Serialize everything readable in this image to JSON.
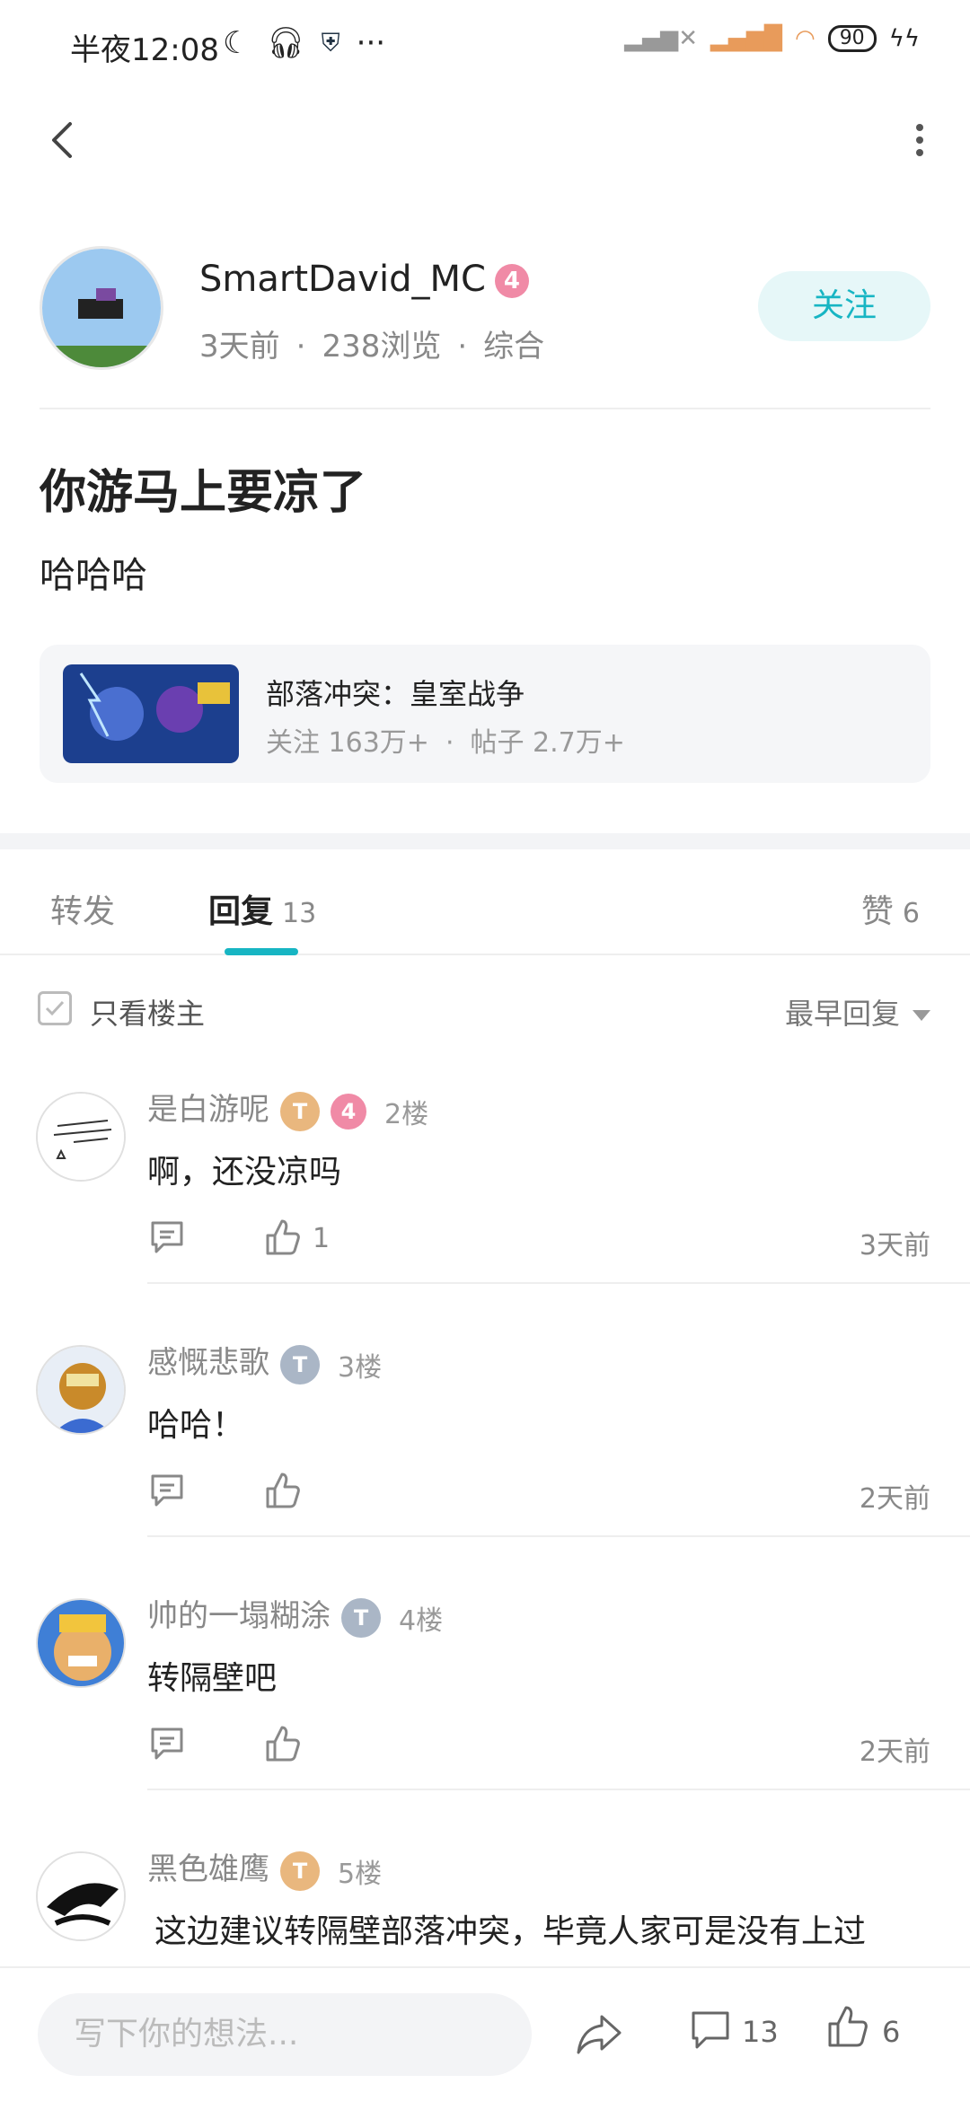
{
  "status_bar": {
    "time": "半夜12:08",
    "battery": "90"
  },
  "author": {
    "name": "SmartDavid_MC",
    "level": "4",
    "time": "3天前",
    "views": "238浏览",
    "category": "综合",
    "follow_label": "关注"
  },
  "post": {
    "title": "你游马上要凉了",
    "body": "哈哈哈"
  },
  "forum": {
    "name": "部落冲突：皇室战争",
    "followers": "关注 163万+",
    "posts": "帖子 2.7万+"
  },
  "tabs": {
    "forward": "转发",
    "reply": "回复",
    "reply_count": "13",
    "like": "赞",
    "like_count": "6"
  },
  "filter": {
    "only_op_label": "只看楼主",
    "sort_label": "最早回复"
  },
  "comments": [
    {
      "name": "是白游呢",
      "badge": "T",
      "level": "4",
      "floor": "2楼",
      "text": "啊，还没凉吗",
      "likes": "1",
      "time": "3天前"
    },
    {
      "name": "感慨悲歌",
      "badge": "T",
      "floor": "3楼",
      "text": "哈哈！",
      "time": "2天前"
    },
    {
      "name": "帅的一塌糊涂",
      "badge": "T",
      "floor": "4楼",
      "text": "转隔壁吧",
      "time": "2天前"
    },
    {
      "name": "黑色雄鹰",
      "badge": "T",
      "floor": "5楼",
      "text": "这边建议转隔壁部落冲突，毕竟人家可是没有上过"
    }
  ],
  "bottom_bar": {
    "placeholder": "写下你的想法...",
    "comment_count": "13",
    "like_count": "6"
  },
  "colors": {
    "accent": "#17b5c3",
    "level_pink": "#f08aa6",
    "badge_gold": "#e9b77e",
    "badge_silver": "#aab6c6"
  }
}
